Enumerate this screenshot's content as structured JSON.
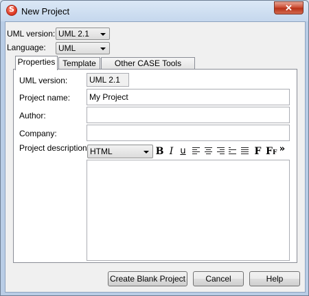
{
  "window": {
    "title": "New Project",
    "close_label": "✕"
  },
  "top": {
    "uml_version_label": "UML version:",
    "uml_version_value": "UML 2.1",
    "language_label": "Language:",
    "language_value": "UML"
  },
  "tabs": [
    {
      "label": "Properties"
    },
    {
      "label": "Template"
    },
    {
      "label": "Other CASE Tools Project"
    }
  ],
  "properties": {
    "uml_version_label": "UML version:",
    "uml_version_value": "UML 2.1",
    "project_name_label": "Project name:",
    "project_name_value": "My Project",
    "author_label": "Author:",
    "author_value": "",
    "company_label": "Company:",
    "company_value": "",
    "description_label": "Project description:",
    "format_value": "HTML"
  },
  "toolbar": {
    "bold": "B",
    "italic": "I",
    "underline": "u",
    "font": "F",
    "font_size": "F",
    "font_size_sub": "F",
    "more": "»"
  },
  "buttons": {
    "create_blank": "Create Blank Project",
    "cancel": "Cancel",
    "help": "Help"
  }
}
